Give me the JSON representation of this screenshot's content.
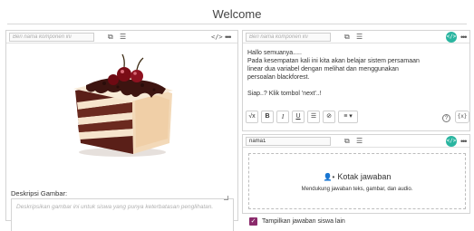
{
  "page": {
    "title": "Welcome"
  },
  "left_panel": {
    "name_placeholder": "Beri nama komponen ini",
    "copy_icon": "copy-icon",
    "menu_icon": "list-icon",
    "code_label": "</>",
    "more_label": "•••",
    "image_desc": "layered chocolate cake with cherries",
    "description_label": "Deskripsi Gambar:",
    "description_placeholder": "Deskripsikan gambar ini untuk siswa yang punya keterbatasan penglihatan."
  },
  "text_panel": {
    "name_placeholder": "Beri nama komponen ini",
    "code_label": "</>",
    "more_label": "•••",
    "lines": [
      "Hallo semuanya.....",
      "Pada kesempatan kali ini kita akan belajar sistem persamaan",
      "linear dua variabel dengan melihat dan menggunakan",
      "persoalan blackforest.",
      "Siap..? Klik tombol 'next'..!"
    ],
    "toolbar": {
      "math": "√x",
      "bold": "B",
      "italic": "I",
      "underline": "U",
      "list": "☰",
      "link": "⊘",
      "align": "≡ ▾",
      "help": "?",
      "variables": "{x}"
    }
  },
  "answer_panel": {
    "name_value": "nama1",
    "code_label": "</>",
    "more_label": "•••",
    "title": "Kotak jawaban",
    "subtitle": "Mendukung jawaban teks, gambar, dan audio."
  },
  "show_answers": {
    "label": "Tampilkan jawaban siswa lain",
    "checked": true
  },
  "colors": {
    "accent": "#2ab5a0",
    "checkbox": "#8a2a6b"
  }
}
